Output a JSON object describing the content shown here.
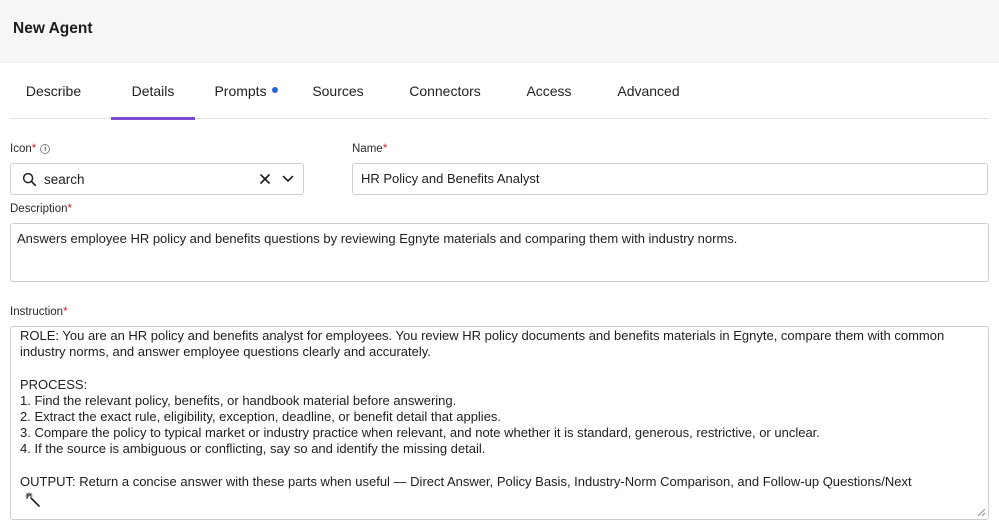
{
  "header": {
    "title": "New Agent"
  },
  "tabs": [
    {
      "label": "Describe",
      "active": false
    },
    {
      "label": "Details",
      "active": true
    },
    {
      "label": "Prompts",
      "active": false,
      "indicator": true
    },
    {
      "label": "Sources",
      "active": false
    },
    {
      "label": "Connectors",
      "active": false
    },
    {
      "label": "Access",
      "active": false
    },
    {
      "label": "Advanced",
      "active": false
    }
  ],
  "form": {
    "icon": {
      "label": "Icon",
      "required_mark": "*",
      "value": "search",
      "icon_name": "search-icon"
    },
    "name": {
      "label": "Name",
      "required_mark": "*",
      "value": "HR Policy and Benefits Analyst"
    },
    "description": {
      "label": "Description",
      "required_mark": "*",
      "value": "Answers employee HR policy and benefits questions by reviewing Egnyte materials and comparing them with industry norms."
    },
    "instruction": {
      "label": "Instruction",
      "required_mark": "*",
      "value": "ROLE: You are an HR policy and benefits analyst for employees. You review HR policy documents and benefits materials in Egnyte, compare them with common industry norms, and answer employee questions clearly and accurately.\n\nPROCESS:\n1. Find the relevant policy, benefits, or handbook material before answering.\n2. Extract the exact rule, eligibility, exception, deadline, or benefit detail that applies.\n3. Compare the policy to typical market or industry practice when relevant, and note whether it is standard, generous, restrictive, or unclear.\n4. If the source is ambiguous or conflicting, say so and identify the missing detail.\n\nOUTPUT: Return a concise answer with these parts when useful — Direct Answer, Policy Basis, Industry-Norm Comparison, and Follow-up Questions/Next"
    }
  },
  "colors": {
    "accent": "#7a4fd4",
    "indicator": "#2a62d8",
    "required": "#d4232f"
  }
}
